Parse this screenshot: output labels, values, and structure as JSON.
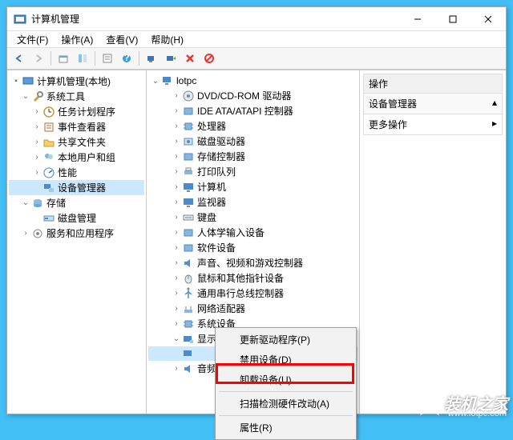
{
  "window": {
    "title": "计算机管理"
  },
  "menu": {
    "file": "文件(F)",
    "action": "操作(A)",
    "view": "查看(V)",
    "help": "帮助(H)"
  },
  "left_tree": {
    "root": "计算机管理(本地)",
    "sys_tools": "系统工具",
    "task_scheduler": "任务计划程序",
    "event_viewer": "事件查看器",
    "shared_folders": "共享文件夹",
    "local_users": "本地用户和组",
    "performance": "性能",
    "device_manager": "设备管理器",
    "storage": "存储",
    "disk_mgmt": "磁盘管理",
    "services_apps": "服务和应用程序"
  },
  "mid_tree": {
    "root": "lotpc",
    "items": [
      "DVD/CD-ROM 驱动器",
      "IDE ATA/ATAPI 控制器",
      "处理器",
      "磁盘驱动器",
      "存储控制器",
      "打印队列",
      "计算机",
      "监视器",
      "键盘",
      "人体学输入设备",
      "软件设备",
      "声音、视频和游戏控制器",
      "鼠标和其他指针设备",
      "通用串行总线控制器",
      "网络适配器",
      "系统设备",
      "显示适配器",
      "音频"
    ],
    "display_child_selected": ""
  },
  "actions": {
    "header": "操作",
    "device_mgr": "设备管理器",
    "more": "更多操作"
  },
  "context": {
    "update_driver": "更新驱动程序(P)",
    "disable": "禁用设备(D)",
    "uninstall": "卸载设备(U)",
    "scan": "扫描检测硬件改动(A)",
    "properties": "属性(R)"
  },
  "watermark": {
    "brand": "装机之家",
    "url": "www.lotpc.com"
  }
}
